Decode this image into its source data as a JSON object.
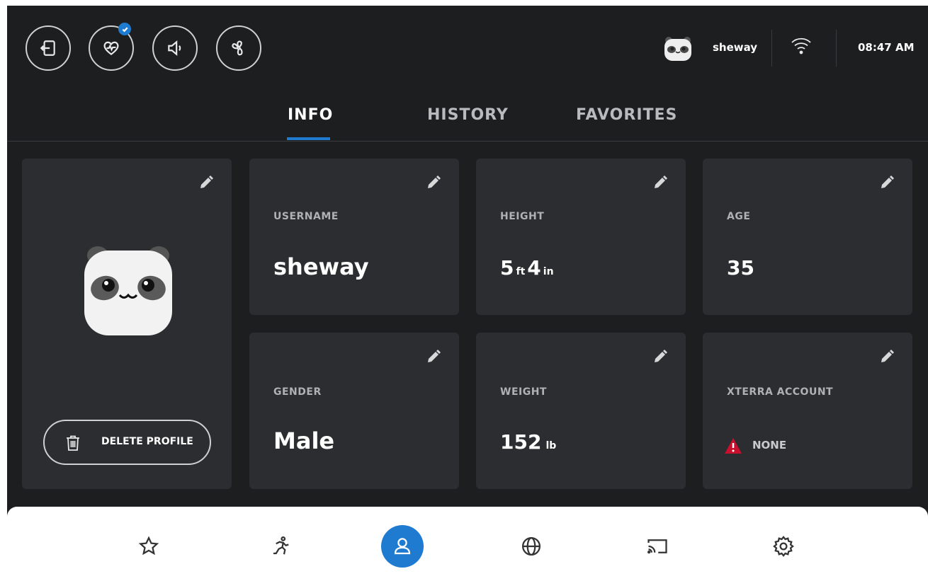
{
  "topbar": {
    "buttons": [
      {
        "name": "exit-button",
        "icon": "exit-icon"
      },
      {
        "name": "heart-rate-button",
        "icon": "heart-rate-icon",
        "badge": "check-badge-icon"
      },
      {
        "name": "volume-button",
        "icon": "speaker-icon"
      },
      {
        "name": "fan-button",
        "icon": "fan-icon"
      }
    ],
    "username": "sheway",
    "wifi_icon": "wifi-icon",
    "time": "08:47 AM"
  },
  "tabs": [
    {
      "label": "INFO",
      "active": true
    },
    {
      "label": "HISTORY",
      "active": false
    },
    {
      "label": "FAVORITES",
      "active": false
    }
  ],
  "profile": {
    "avatar": "panda-avatar",
    "delete_label": "DELETE PROFILE"
  },
  "cards": {
    "username": {
      "label": "USERNAME",
      "value": "sheway"
    },
    "height": {
      "label": "HEIGHT",
      "feet": "5",
      "feet_unit": "ft",
      "inches": "4",
      "inches_unit": "in"
    },
    "age": {
      "label": "AGE",
      "value": "35"
    },
    "gender": {
      "label": "GENDER",
      "value": "Male"
    },
    "weight": {
      "label": "WEIGHT",
      "value": "152",
      "unit": "lb"
    },
    "xterra": {
      "label": "XTERRA ACCOUNT",
      "value": "NONE"
    }
  },
  "bottomnav": [
    {
      "icon": "star-icon",
      "active": false
    },
    {
      "icon": "running-icon",
      "active": false
    },
    {
      "icon": "user-icon",
      "active": true
    },
    {
      "icon": "globe-icon",
      "active": false
    },
    {
      "icon": "cast-icon",
      "active": false
    },
    {
      "icon": "gear-icon",
      "active": false
    }
  ],
  "colors": {
    "background": "#1d1e20",
    "card": "#2c2d30",
    "accent": "#1e7bd0",
    "warning": "#c8102e"
  }
}
